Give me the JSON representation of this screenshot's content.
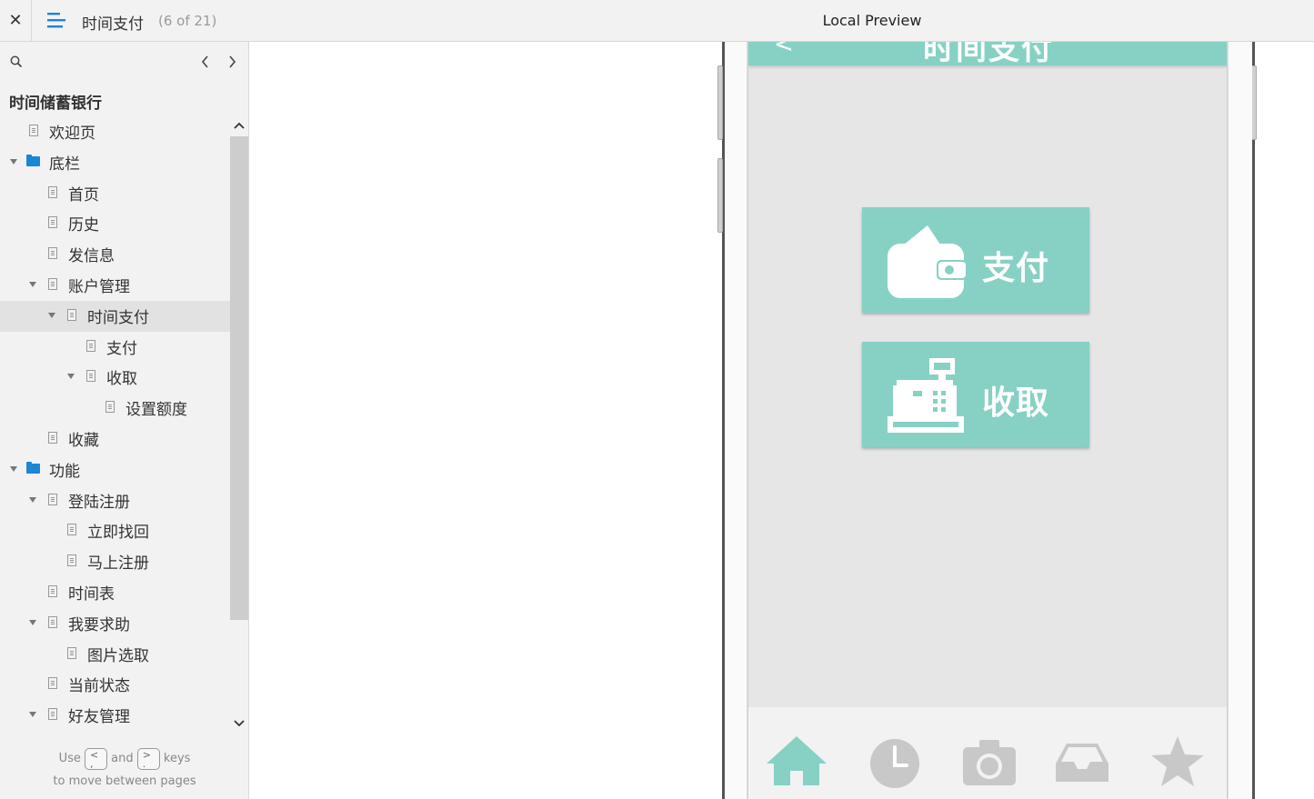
{
  "topbar": {
    "close_label": "✕",
    "page_name": "时间支付",
    "page_count": "(6 of 21)",
    "preview_title": "Local Preview"
  },
  "sidebar": {
    "project_title": "时间储蓄银行",
    "items": [
      {
        "label": "欢迎页",
        "type": "page",
        "level": 1,
        "expanded": false
      },
      {
        "label": "底栏",
        "type": "folder",
        "level": 1,
        "expanded": true
      },
      {
        "label": "首页",
        "type": "page",
        "level": 2,
        "expanded": false
      },
      {
        "label": "历史",
        "type": "page",
        "level": 2,
        "expanded": false
      },
      {
        "label": "发信息",
        "type": "page",
        "level": 2,
        "expanded": false
      },
      {
        "label": "账户管理",
        "type": "page",
        "level": 2,
        "expanded": true
      },
      {
        "label": "时间支付",
        "type": "page",
        "level": 3,
        "expanded": true,
        "selected": true
      },
      {
        "label": "支付",
        "type": "page",
        "level": 4,
        "expanded": false
      },
      {
        "label": "收取",
        "type": "page",
        "level": 4,
        "expanded": true
      },
      {
        "label": "设置额度",
        "type": "page",
        "level": 5,
        "expanded": false
      },
      {
        "label": "收藏",
        "type": "page",
        "level": 2,
        "expanded": false
      },
      {
        "label": "功能",
        "type": "folder",
        "level": 1,
        "expanded": true
      },
      {
        "label": "登陆注册",
        "type": "page",
        "level": 2,
        "expanded": true
      },
      {
        "label": "立即找回",
        "type": "page",
        "level": 3,
        "expanded": false
      },
      {
        "label": "马上注册",
        "type": "page",
        "level": 3,
        "expanded": false
      },
      {
        "label": "时间表",
        "type": "page",
        "level": 2,
        "expanded": false
      },
      {
        "label": "我要求助",
        "type": "page",
        "level": 2,
        "expanded": true
      },
      {
        "label": "图片选取",
        "type": "page",
        "level": 3,
        "expanded": false
      },
      {
        "label": "当前状态",
        "type": "page",
        "level": 2,
        "expanded": false
      },
      {
        "label": "好友管理",
        "type": "page",
        "level": 2,
        "expanded": true
      }
    ],
    "hint": {
      "use": "Use",
      "key_prev": "<\n,",
      "and": "and",
      "key_next": ">\n.",
      "keys": "keys",
      "line2": "to move between pages"
    }
  },
  "app": {
    "header_title": "时间支付",
    "back_glyph": "<",
    "pay_button_label": "支付",
    "collect_button_label": "收取",
    "tabs": [
      "home-icon",
      "clock-icon",
      "camera-icon",
      "inbox-icon",
      "star-icon"
    ],
    "colors": {
      "accent": "#87d1c4",
      "tab_inactive": "#c8c8c8",
      "folder": "#1a86d6"
    }
  }
}
